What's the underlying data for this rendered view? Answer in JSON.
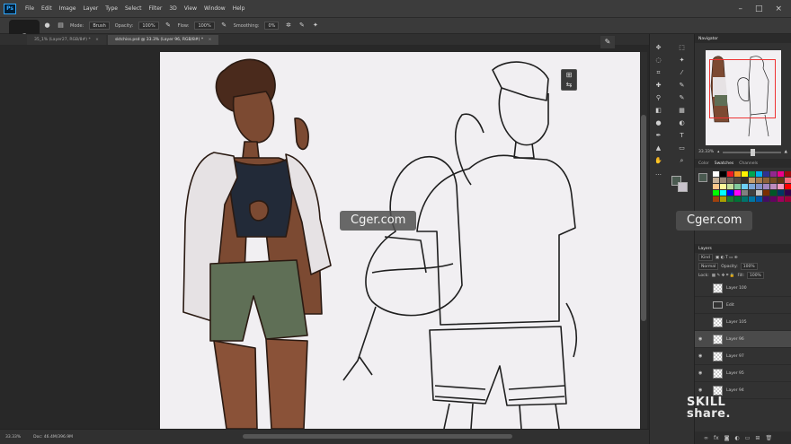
{
  "menubar": {
    "app_icon": "Ps",
    "items": [
      "File",
      "Edit",
      "Image",
      "Layer",
      "Type",
      "Select",
      "Filter",
      "3D",
      "View",
      "Window",
      "Help"
    ]
  },
  "options": {
    "mode_label": "Mode:",
    "mode_value": "Brush",
    "opacity_label": "Opacity:",
    "opacity_value": "100%",
    "flow_label": "Flow:",
    "flow_value": "100%",
    "smoothing_label": "Smoothing:",
    "smoothing_value": "0%"
  },
  "overlay": {
    "badge": "e"
  },
  "tabs": [
    {
      "label": "35_1% (Layer27, RGB/8#) *",
      "close": "×"
    },
    {
      "label": "sktchiss.psd @ 33.3% (Layer 96, RGB/8#) *",
      "close": "×"
    }
  ],
  "status": {
    "zoom": "33.33%",
    "doc": "Doc: 46.4M/396.9M"
  },
  "navigator": {
    "tabs": [
      "Navigator"
    ],
    "zoom": "33.33%"
  },
  "swatches": {
    "tabs": [
      "Color",
      "Swatches",
      "Channels"
    ],
    "colors": [
      "#ffffff",
      "#000000",
      "#ed1c24",
      "#f7941d",
      "#fff200",
      "#00a651",
      "#00aeef",
      "#2e3192",
      "#92278f",
      "#ec008c",
      "#9e0b0f",
      "#603913",
      "#c7b299",
      "#998675",
      "#736357",
      "#534741",
      "#362f2d",
      "#c69c6d",
      "#a67c52",
      "#8c6239",
      "#754c24",
      "#603813",
      "#f26d7d",
      "#f69679",
      "#fdc689",
      "#fff799",
      "#c4df9b",
      "#82ca9c",
      "#6dcff6",
      "#7da7d9",
      "#8393ca",
      "#a186be",
      "#bd8cbf",
      "#f49ac1",
      "#ff0000",
      "#ffff00",
      "#00ff00",
      "#00ffff",
      "#0000ff",
      "#ff00ff",
      "#808080",
      "#404040",
      "#c0c0c0",
      "#7b2e00",
      "#005826",
      "#003663",
      "#32004b",
      "#4b0049",
      "#a0410d",
      "#aba000",
      "#197b30",
      "#007236",
      "#00746b",
      "#0076a3",
      "#0054a6",
      "#440e62",
      "#630460",
      "#9e005d",
      "#9e0039",
      "#ffffff"
    ]
  },
  "layers": {
    "tab": "Layers",
    "kind_label": "Kind",
    "blend": "Normal",
    "opacity_label": "Opacity:",
    "opacity_value": "100%",
    "lock_label": "Lock:",
    "fill_label": "Fill:",
    "fill_value": "100%",
    "items": [
      {
        "name": "Layer 100",
        "type": "layer",
        "visible": "",
        "selected": false
      },
      {
        "name": "Edit",
        "type": "folder",
        "visible": "",
        "selected": false
      },
      {
        "name": "Layer 105",
        "type": "layer",
        "visible": "",
        "selected": false
      },
      {
        "name": "Layer 96",
        "type": "layer",
        "visible": "◉",
        "selected": true
      },
      {
        "name": "Layer 97",
        "type": "layer",
        "visible": "◉",
        "selected": false
      },
      {
        "name": "Layer 95",
        "type": "layer",
        "visible": "◉",
        "selected": false
      },
      {
        "name": "Layer 94",
        "type": "layer",
        "visible": "◉",
        "selected": false
      }
    ]
  },
  "watermarks": {
    "left": "Cger.com",
    "right": "Cger.com"
  },
  "brand": {
    "line1": "SKILL",
    "line2": "share."
  }
}
